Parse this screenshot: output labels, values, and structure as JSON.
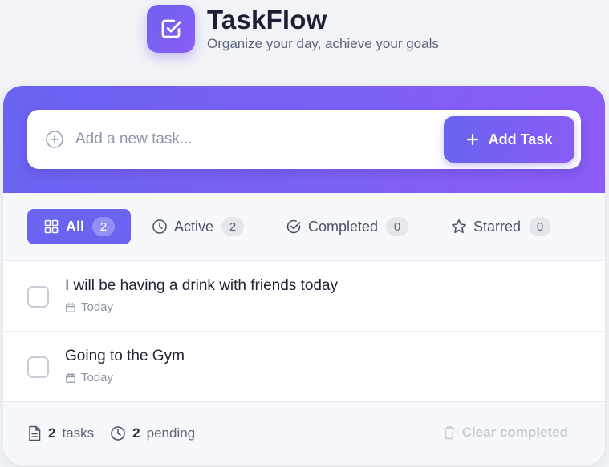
{
  "app": {
    "title": "TaskFlow",
    "subtitle": "Organize your day, achieve your goals"
  },
  "composer": {
    "placeholder": "Add a new task...",
    "add_label": "Add Task"
  },
  "filters": [
    {
      "label": "All",
      "count": "2",
      "icon": "grid-icon",
      "active": true
    },
    {
      "label": "Active",
      "count": "2",
      "icon": "clock-icon",
      "active": false
    },
    {
      "label": "Completed",
      "count": "0",
      "icon": "check-circle-icon",
      "active": false
    },
    {
      "label": "Starred",
      "count": "0",
      "icon": "star-icon",
      "active": false
    }
  ],
  "tasks": [
    {
      "text": "I will be having a drink with friends today",
      "due": "Today",
      "done": false
    },
    {
      "text": "Going to the Gym",
      "due": "Today",
      "done": false
    }
  ],
  "footer": {
    "tasks_count": "2",
    "tasks_label": "tasks",
    "pending_count": "2",
    "pending_label": "pending",
    "clear_label": "Clear completed"
  },
  "colors": {
    "accent": "#6a64f1",
    "accent_end": "#8b5cf6",
    "background": "#f1f3f7"
  }
}
